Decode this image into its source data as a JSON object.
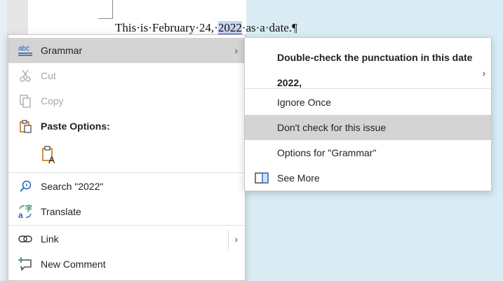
{
  "document": {
    "before": "This·is·February·24,·",
    "selected": "2022",
    "after": "·as·a·date.¶"
  },
  "context_menu": {
    "grammar": "Grammar",
    "cut": "Cut",
    "copy": "Copy",
    "paste_options": "Paste Options:",
    "search": "Search \"2022\"",
    "translate": "Translate",
    "link": "Link",
    "new_comment": "New Comment"
  },
  "submenu": {
    "heading_line1": "Double-check the punctuation in this date",
    "heading_line2": "2022,",
    "ignore_once": "Ignore Once",
    "dont_check": "Don't check for this issue",
    "options": "Options for \"Grammar\"",
    "see_more": "See More"
  },
  "icons": {
    "grammar": "abc-spellcheck-icon",
    "cut": "scissors-icon",
    "copy": "copy-icon",
    "paste": "clipboard-icon",
    "paste_keep_text": "paste-text-only-icon",
    "search": "search-icon",
    "translate": "translate-icon",
    "link": "link-icon",
    "comment": "new-comment-icon",
    "see_more": "pane-icon"
  },
  "colors": {
    "highlight": "#d4d4d4",
    "accent": "#1f5fbf",
    "document_bg": "#d9ecf4"
  }
}
